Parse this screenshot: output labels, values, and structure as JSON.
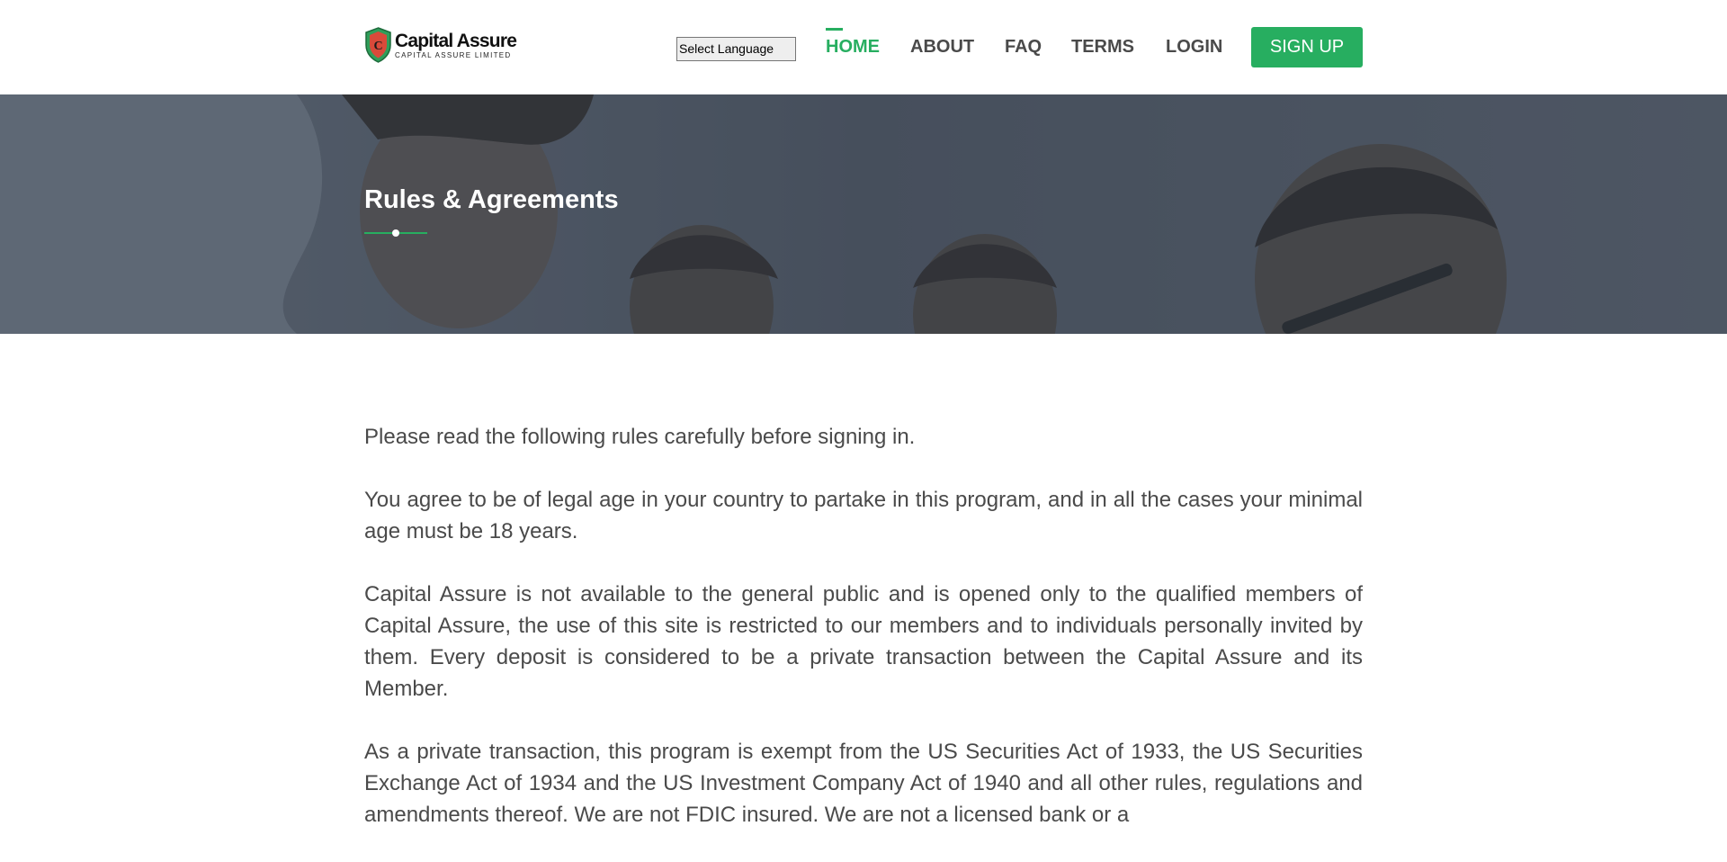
{
  "brand": {
    "name": "Capital Assure",
    "tagline": "CAPITAL ASSURE LIMITED",
    "logo_icon": "shield-icon",
    "accent_color": "#27ae60"
  },
  "language_select": {
    "selected": "Select Language"
  },
  "nav": {
    "items": [
      {
        "label": "HOME",
        "active": true
      },
      {
        "label": "ABOUT",
        "active": false
      },
      {
        "label": "FAQ",
        "active": false
      },
      {
        "label": "TERMS",
        "active": false
      },
      {
        "label": "LOGIN",
        "active": false
      }
    ],
    "signup_label": "SIGN UP"
  },
  "banner": {
    "title": "Rules & Agreements"
  },
  "content": {
    "paragraphs": [
      "Please read the following rules carefully before signing in.",
      "You agree to be of legal age in your country to partake in this program, and in all the cases your minimal age must be 18 years.",
      "Capital Assure is not available to the general public and is opened only to the qualified members of Capital Assure, the use of this site is restricted to our members and to individuals personally invited by them. Every deposit is considered to be a private transaction between the Capital Assure and its Member.",
      "As a private transaction, this program is exempt from the US Securities Act of 1933, the US Securities Exchange Act of 1934 and the US Investment Company Act of 1940 and all other rules, regulations and amendments thereof. We are not FDIC insured. We are not a licensed bank or a"
    ]
  }
}
